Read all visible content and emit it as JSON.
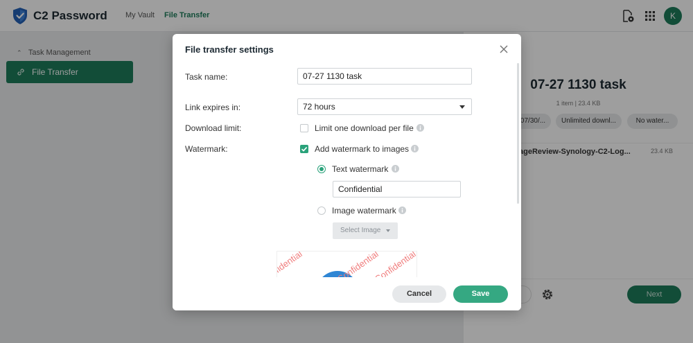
{
  "app": {
    "title": "C2 Password",
    "avatar_initial": "K"
  },
  "nav": {
    "links": [
      "My Vault",
      "File Transfer"
    ],
    "active": "File Transfer"
  },
  "sidebar": {
    "group_label": "Task Management",
    "items": [
      {
        "label": "File Transfer"
      }
    ]
  },
  "detail": {
    "title": "07-27 1130 task",
    "summary": "1 item | 23.4 KB",
    "chips": [
      "07/30/...",
      "Unlimited downl...",
      "No water..."
    ],
    "file": {
      "name": "ageReview-Synology-C2-Log...",
      "size": "23.4 KB"
    },
    "next_label": "Next"
  },
  "modal": {
    "title": "File transfer settings",
    "task_name": {
      "label": "Task name:",
      "value": "07-27 1130 task"
    },
    "link_expires": {
      "label": "Link expires in:",
      "value": "72 hours"
    },
    "download_limit": {
      "label": "Download limit:",
      "option_label": "Limit one download per file",
      "checked": false
    },
    "watermark": {
      "label": "Watermark:",
      "option_label": "Add watermark to images",
      "checked": true,
      "text_option": {
        "label": "Text watermark",
        "selected": true,
        "value": "Confidential"
      },
      "image_option": {
        "label": "Image watermark",
        "selected": false,
        "button_label": "Select Image"
      },
      "preview_text": "Confidential"
    },
    "cancel_label": "Cancel",
    "save_label": "Save"
  },
  "colors": {
    "accent": "#1e7c5b",
    "save": "#35a882",
    "watermark_preview": "#f07e7e"
  },
  "icons": {
    "logo": "shield-logo-icon",
    "top_actions": [
      "file-settings-icon",
      "app-grid-icon"
    ],
    "sidebar": "link-icon",
    "close": "close-icon",
    "info": "info-icon",
    "gear": "gear-icon"
  }
}
